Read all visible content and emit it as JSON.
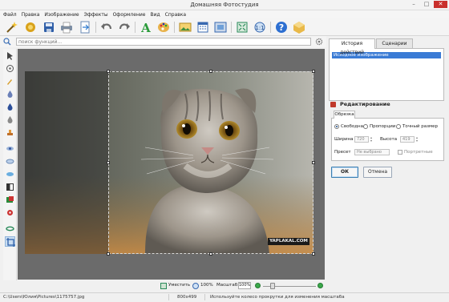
{
  "window": {
    "title": "Домашняя Фотостудия",
    "controls": {
      "minimize": "–",
      "maximize": "□",
      "close": "✕"
    }
  },
  "menu": [
    "Файл",
    "Правка",
    "Изображение",
    "Эффекты",
    "Оформление",
    "Вид",
    "Справка"
  ],
  "toolbar": {
    "buttons": [
      "wizard-icon",
      "open-icon",
      "save-icon",
      "print-icon",
      "export-icon",
      "undo-icon",
      "redo-icon",
      "text-icon",
      "palette-icon",
      "image-icon",
      "calendar-icon",
      "frame-icon",
      "fit-icon",
      "zoom-icon",
      "help-icon",
      "box-icon"
    ]
  },
  "search": {
    "placeholder": "поиск функций..."
  },
  "tools": [
    "select-tool-icon",
    "rotate-tool-icon",
    "brush-tool-icon",
    "drop-tool-icon",
    "eyedropper-tool-icon",
    "fill-tool-icon",
    "stamp-tool-icon",
    "eye-tool-icon",
    "lens-tool-icon",
    "dodge-tool-icon",
    "contrast-tool-icon",
    "layers-tool-icon",
    "redeye-tool-icon",
    "crop-tool-icon"
  ],
  "canvas": {
    "watermark": "YAPLAKAL.COM"
  },
  "panel": {
    "tabs": {
      "history": "История действий",
      "scenarios": "Сценарии"
    },
    "history_items": [
      "Исходное изображение"
    ],
    "edit_title": "Редактирование",
    "crop_tab": "Обрезка",
    "modes": {
      "free": "Свободная",
      "proportional": "Пропорции",
      "exact": "Точный размер"
    },
    "width_label": "Ширина",
    "width_value": "720",
    "height_label": "Высота",
    "height_value": "419",
    "preset_label": "Пресет",
    "preset_value": "Не выбрано",
    "portrait_label": "Портретные",
    "ok": "ОК",
    "cancel": "Отмена"
  },
  "status": {
    "fit_label": "Уместить",
    "zoom_100_label": "100%",
    "scale_label": "Масштаб:",
    "scale_value": "100%",
    "file_path": "C:\\Users\\Юлия\\Pictures\\1175757.jpg",
    "dimensions": "800x499",
    "hint": "Используйте колесо прокрутки для изменения масштаба"
  },
  "colors": {
    "selection": "#3a7bd5",
    "close_button": "#c9302c",
    "workspace": "#6b6b6b",
    "zoom_green": "#3aa84a"
  }
}
